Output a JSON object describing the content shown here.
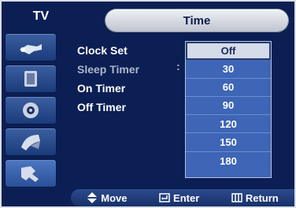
{
  "header": {
    "tab": "TV",
    "title": "Time"
  },
  "sidebar": {
    "icons": [
      {
        "name": "picture-icon"
      },
      {
        "name": "sound-icon"
      },
      {
        "name": "speaker-icon"
      },
      {
        "name": "channel-icon"
      },
      {
        "name": "setup-icon",
        "active": true
      }
    ]
  },
  "menu": {
    "items": [
      {
        "label": "Clock Set"
      },
      {
        "label": "Sleep Timer"
      },
      {
        "label": "On Timer"
      },
      {
        "label": "Off Timer"
      }
    ],
    "separator": ":"
  },
  "dropdown": {
    "selected": "Off",
    "options": [
      "Off",
      "30",
      "60",
      "90",
      "120",
      "150",
      "180"
    ]
  },
  "footer": {
    "hints": [
      {
        "icon": "updown-icon",
        "label": "Move"
      },
      {
        "icon": "enter-icon",
        "label": "Enter"
      },
      {
        "icon": "return-icon",
        "label": "Return"
      }
    ]
  },
  "colors": {
    "background": "#0b1f54",
    "panel": "#3e65b6",
    "highlight": "#d4dbe9"
  }
}
